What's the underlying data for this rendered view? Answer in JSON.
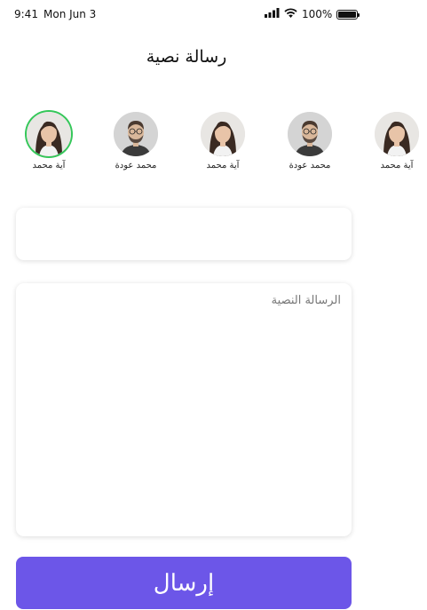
{
  "status_bar": {
    "time": "9:41",
    "date": "Mon Jun 3",
    "battery": "100%",
    "battery_level": 1.0
  },
  "header": {
    "title": "رسالة نصية"
  },
  "contacts": [
    {
      "name": "آية محمد",
      "avatar": "female-avatar",
      "selected": true
    },
    {
      "name": "محمد عودة",
      "avatar": "male-avatar",
      "selected": false
    },
    {
      "name": "آية محمد",
      "avatar": "female-avatar",
      "selected": false
    },
    {
      "name": "محمد عودة",
      "avatar": "male-avatar",
      "selected": false
    },
    {
      "name": "آية محمد",
      "avatar": "female-avatar",
      "selected": false
    }
  ],
  "form": {
    "subject_value": "",
    "message_placeholder": "الرسالة النصية"
  },
  "send_button": {
    "label": "إرسال",
    "color": "#6c56e8"
  },
  "colors": {
    "selected_ring": "#34c759"
  }
}
